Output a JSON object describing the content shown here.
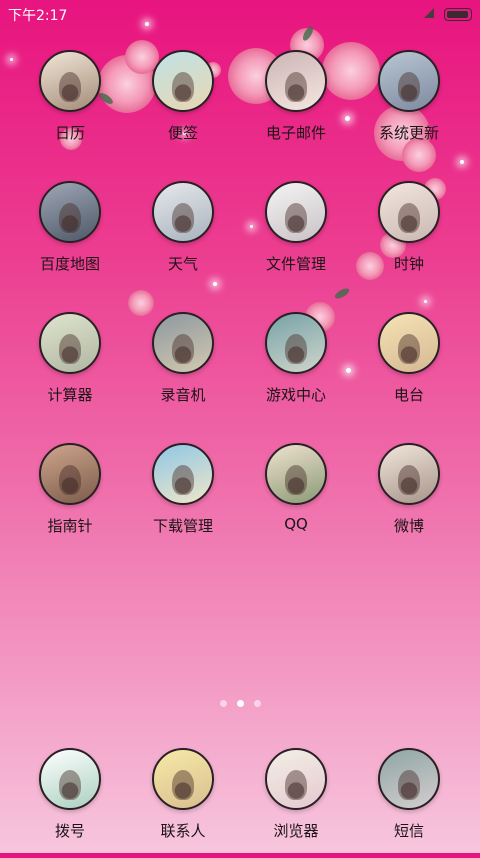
{
  "status_bar": {
    "time": "下午2:17"
  },
  "pager": {
    "page_count": 3,
    "active_index": 1
  },
  "apps": [
    {
      "label": "日历",
      "c1": "#f1e6d8",
      "c2": "#a48c78"
    },
    {
      "label": "便签",
      "c1": "#bfe3e6",
      "c2": "#e9d6b2"
    },
    {
      "label": "电子邮件",
      "c1": "#cbb6b6",
      "c2": "#f5e6e0"
    },
    {
      "label": "系统更新",
      "c1": "#b9c6d2",
      "c2": "#7d8aa0"
    },
    {
      "label": "百度地图",
      "c1": "#9fa7b6",
      "c2": "#4e5866"
    },
    {
      "label": "天气",
      "c1": "#e6e8ec",
      "c2": "#a8b3bd"
    },
    {
      "label": "文件管理",
      "c1": "#f4f4f4",
      "c2": "#c9c2c6"
    },
    {
      "label": "时钟",
      "c1": "#f2e6de",
      "c2": "#c9b8b1"
    },
    {
      "label": "计算器",
      "c1": "#dfe4cf",
      "c2": "#b0b6a1"
    },
    {
      "label": "录音机",
      "c1": "#8e98a0",
      "c2": "#d2c9b0"
    },
    {
      "label": "游戏中心",
      "c1": "#77a2a6",
      "c2": "#cfd6cc"
    },
    {
      "label": "电台",
      "c1": "#f4e3b4",
      "c2": "#d6b894"
    },
    {
      "label": "指南针",
      "c1": "#cfa58c",
      "c2": "#7b5c4b"
    },
    {
      "label": "下载管理",
      "c1": "#8fc7e6",
      "c2": "#f0e6c9"
    },
    {
      "label": "QQ",
      "c1": "#efe2cf",
      "c2": "#8a9a76"
    },
    {
      "label": "微博",
      "c1": "#f1e6dc",
      "c2": "#a69488"
    }
  ],
  "dock": [
    {
      "label": "拨号",
      "c1": "#ffffff",
      "c2": "#a9d0bf"
    },
    {
      "label": "联系人",
      "c1": "#f7e9a8",
      "c2": "#d8bf8f"
    },
    {
      "label": "浏览器",
      "c1": "#f3efe6",
      "c2": "#e4c9cf"
    },
    {
      "label": "短信",
      "c1": "#8fa6a4",
      "c2": "#d4cdcf"
    }
  ]
}
